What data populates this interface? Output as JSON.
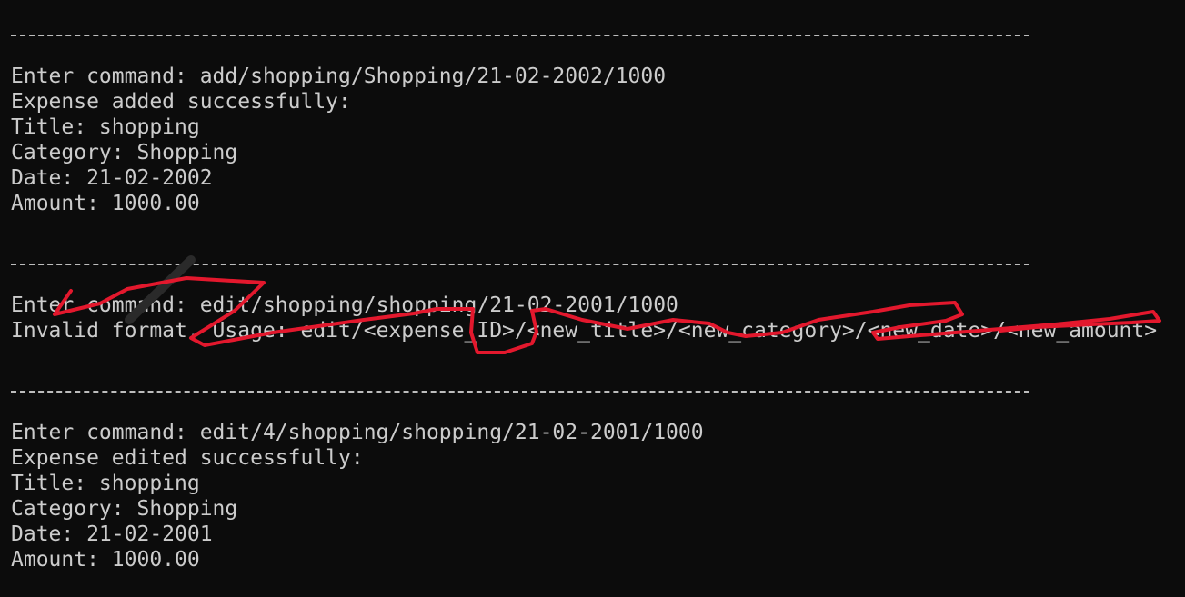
{
  "terminal": {
    "block1": {
      "command": "Enter command: add/shopping/Shopping/21-02-2002/1000",
      "result": "Expense added successfully:",
      "title": "Title: shopping",
      "category": "Category: Shopping",
      "date": "Date: 21-02-2002",
      "amount": "Amount: 1000.00"
    },
    "block2": {
      "command": "Enter command: edit/shopping/shopping/21-02-2001/1000",
      "error": "Invalid format. Usage: edit/<expense_ID>/<new_title>/<new_category>/<new_date>/<new_amount>"
    },
    "block3": {
      "command": "Enter command: edit/4/shopping/shopping/21-02-2001/1000",
      "result": "Expense edited successfully:",
      "title": "Title: shopping",
      "category": "Category: Shopping",
      "date": "Date: 21-02-2001",
      "amount": "Amount: 1000.00"
    }
  },
  "colors": {
    "background": "#0c0c0c",
    "text": "#cccccc",
    "scribble": "#e3182d"
  }
}
